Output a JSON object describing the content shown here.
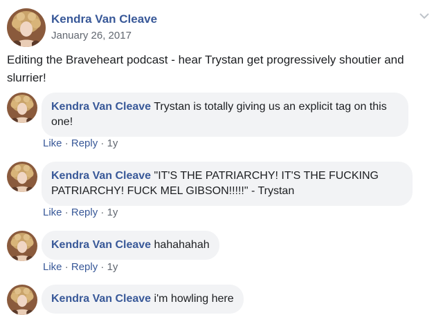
{
  "post": {
    "author": "Kendra Van Cleave",
    "date": "January 26, 2017",
    "text": "Editing the Braveheart podcast - hear Trystan get progressively shoutier and slurrier!"
  },
  "comments": [
    {
      "author": "Kendra Van Cleave",
      "text": "Trystan is totally giving us an explicit tag on this one!",
      "like": "Like",
      "reply": "Reply",
      "time": "1y"
    },
    {
      "author": "Kendra Van Cleave",
      "text": "\"IT'S THE PATRIARCHY! IT'S THE FUCKING PATRIARCHY! FUCK MEL GIBSON!!!!!\" - Trystan",
      "like": "Like",
      "reply": "Reply",
      "time": "1y"
    },
    {
      "author": "Kendra Van Cleave",
      "text": "hahahahah",
      "like": "Like",
      "reply": "Reply",
      "time": "1y"
    },
    {
      "author": "Kendra Van Cleave",
      "text": "i'm howling here"
    }
  ],
  "icons": {
    "menu": "chevron-down-icon"
  },
  "colors": {
    "name": "#385898",
    "bubble": "#f2f3f5",
    "meta": "#616770"
  }
}
